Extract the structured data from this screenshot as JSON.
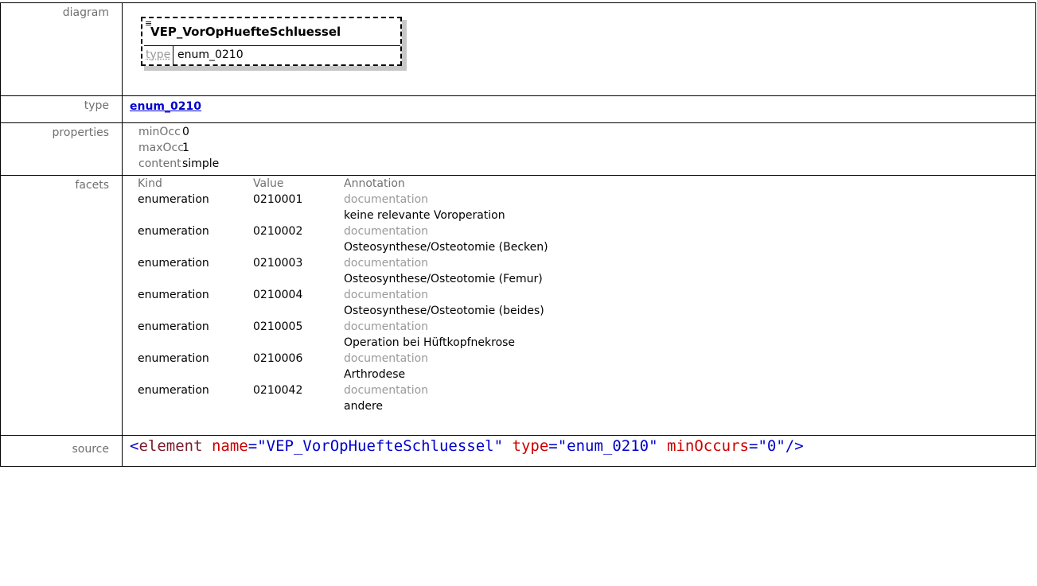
{
  "labels": {
    "diagram": "diagram",
    "type": "type",
    "properties": "properties",
    "facets": "facets",
    "source": "source"
  },
  "diagram": {
    "name": "VEP_VorOpHuefteSchluessel",
    "type_label": "type",
    "type_value": "enum_0210"
  },
  "type": {
    "value": "enum_0210"
  },
  "properties": [
    {
      "key": "minOcc",
      "value": "0"
    },
    {
      "key": "maxOcc",
      "value": "1"
    },
    {
      "key": "content",
      "value": "simple"
    }
  ],
  "facets": {
    "headers": {
      "kind": "Kind",
      "value": "Value",
      "annotation": "Annotation"
    },
    "rows": [
      {
        "kind": "enumeration",
        "value": "0210001",
        "annotation_label": "documentation",
        "annotation": "keine relevante Voroperation"
      },
      {
        "kind": "enumeration",
        "value": "0210002",
        "annotation_label": "documentation",
        "annotation": "Osteosynthese/Osteotomie (Becken)"
      },
      {
        "kind": "enumeration",
        "value": "0210003",
        "annotation_label": "documentation",
        "annotation": "Osteosynthese/Osteotomie (Femur)"
      },
      {
        "kind": "enumeration",
        "value": "0210004",
        "annotation_label": "documentation",
        "annotation": "Osteosynthese/Osteotomie (beides)"
      },
      {
        "kind": "enumeration",
        "value": "0210005",
        "annotation_label": "documentation",
        "annotation": "Operation bei Hüftkopfnekrose"
      },
      {
        "kind": "enumeration",
        "value": "0210006",
        "annotation_label": "documentation",
        "annotation": "Arthrodese"
      },
      {
        "kind": "enumeration",
        "value": "0210042",
        "annotation_label": "documentation",
        "annotation": "andere"
      }
    ]
  },
  "source": {
    "open": "<",
    "tag": "element",
    "attrs": [
      {
        "name": "name",
        "value": "\"VEP_VorOpHuefteSchluessel\""
      },
      {
        "name": "type",
        "value": "\"enum_0210\""
      },
      {
        "name": "minOccurs",
        "value": "\"0\""
      }
    ],
    "close": "/>"
  },
  "colors": {
    "link": "#0000cc",
    "label_gray": "#707070",
    "xml_tag": "#7a1a2a",
    "xml_attr": "#cc0000",
    "xml_value": "#0000cc"
  }
}
